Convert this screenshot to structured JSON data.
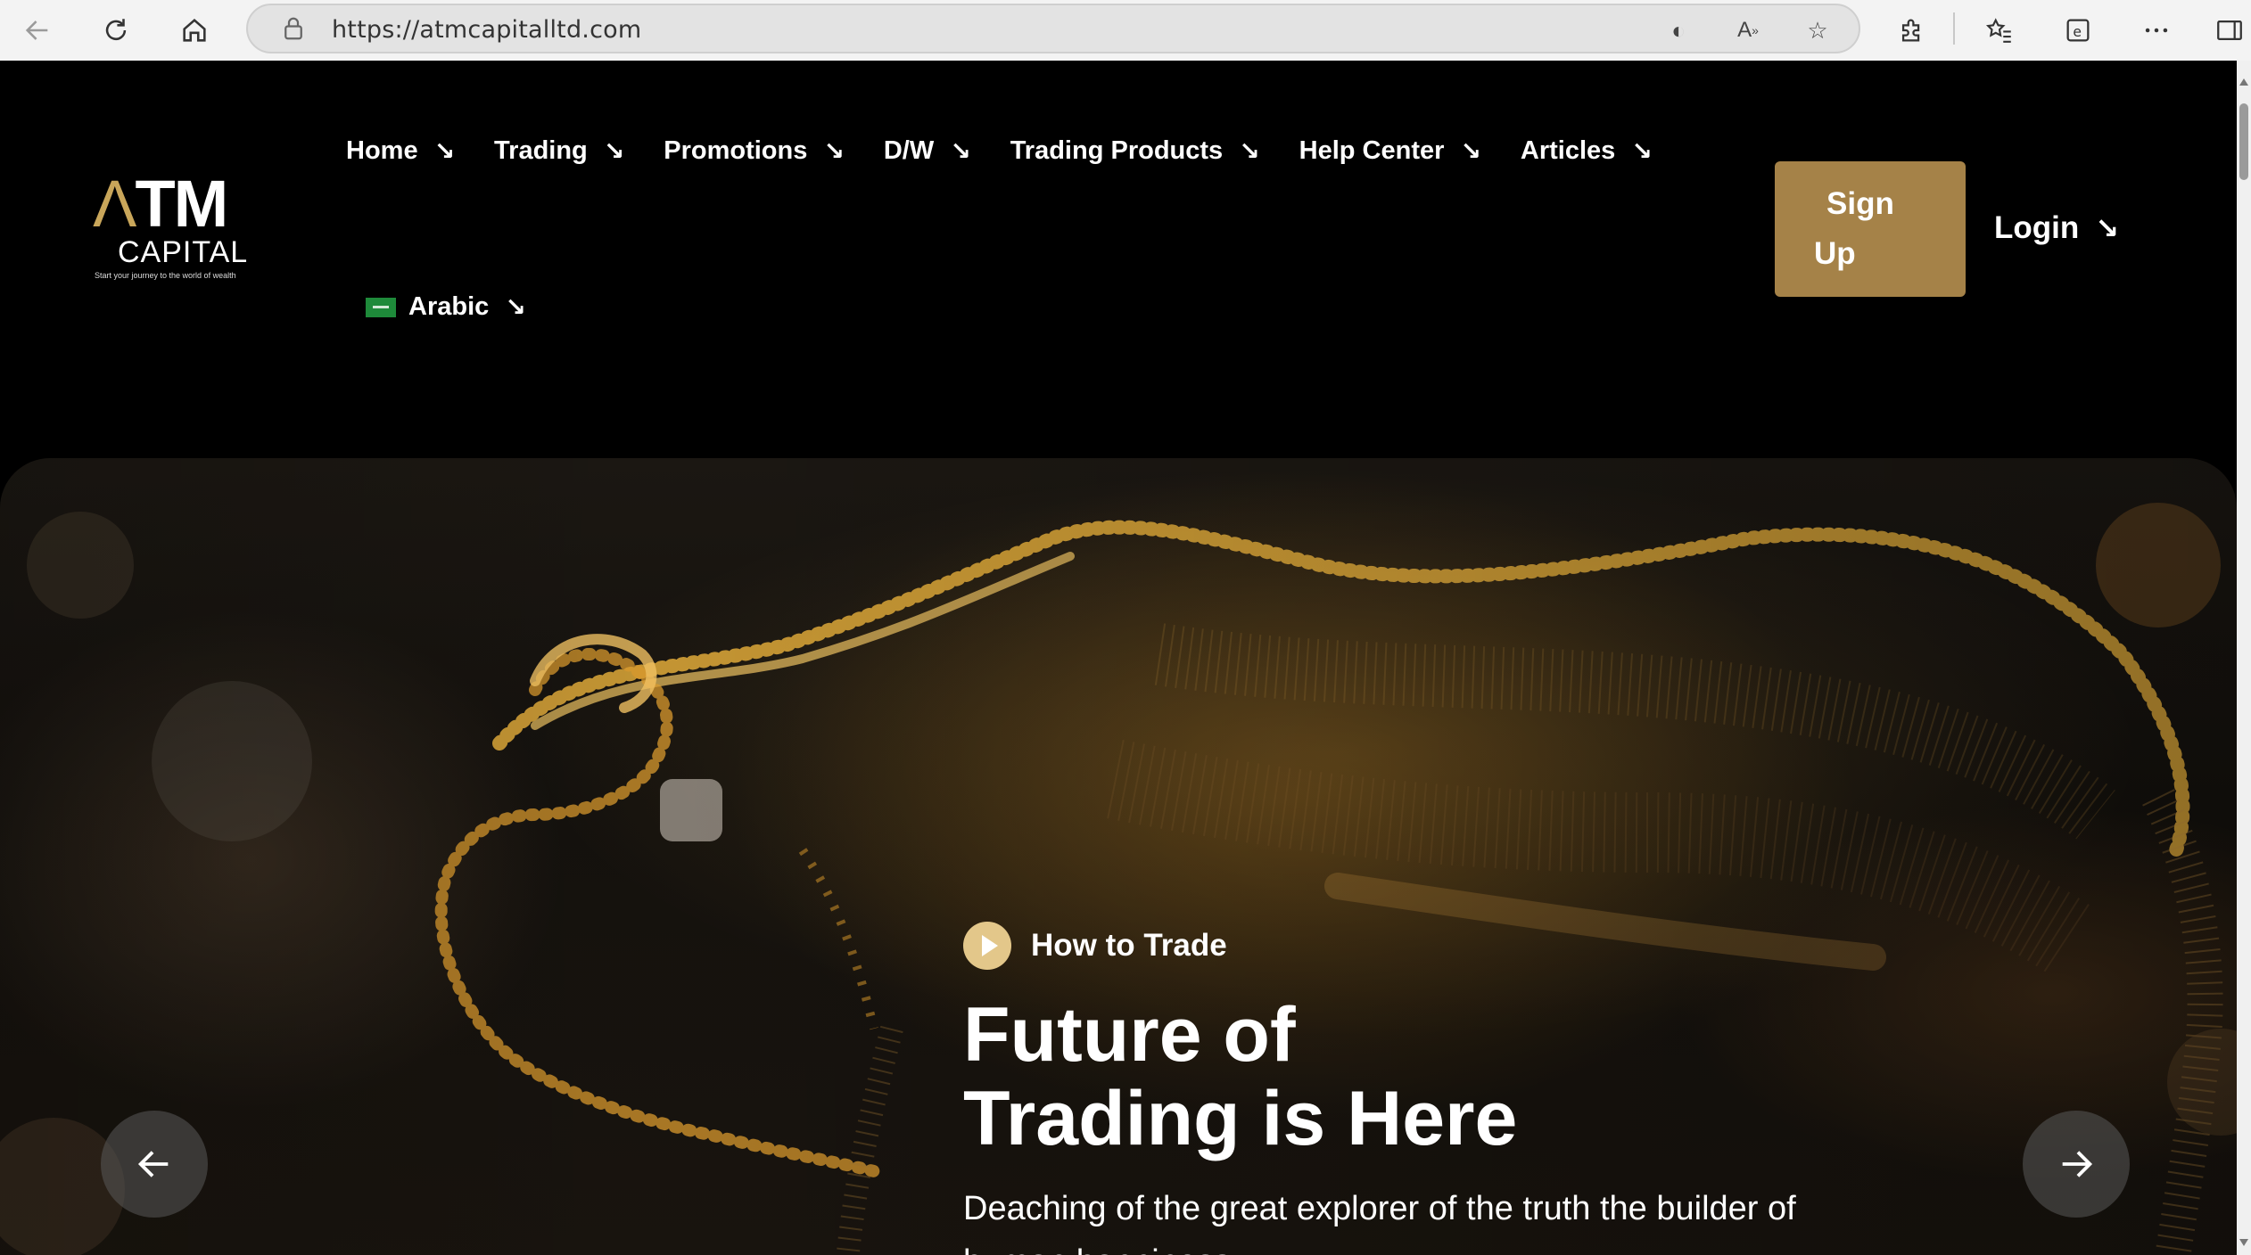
{
  "browser": {
    "url": "https://atmcapitalltd.com",
    "icons": {
      "back": "arrow-left-icon",
      "refresh": "refresh-icon",
      "home": "home-icon",
      "lock": "lock-icon",
      "tracking": "tracking-icon",
      "read_aloud": "read-aloud-icon",
      "favorite": "star-icon",
      "extensions": "puzzle-icon",
      "favorites": "favorites-list-icon",
      "collections": "collections-icon",
      "more": "more-dots-icon",
      "sidebar": "sidebar-icon"
    }
  },
  "logo": {
    "mark": "ATM",
    "subtitle": "CAPITAL",
    "tagline": "Start your journey to the world of wealth"
  },
  "nav": {
    "items": [
      {
        "label": "Home",
        "arrow": "↘"
      },
      {
        "label": "Trading",
        "arrow": "↘"
      },
      {
        "label": "Promotions",
        "arrow": "↘"
      },
      {
        "label": "D/W",
        "arrow": "↘"
      },
      {
        "label": "Trading Products",
        "arrow": "↘"
      },
      {
        "label": "Help Center",
        "arrow": "↘"
      },
      {
        "label": "Articles",
        "arrow": "↘"
      }
    ],
    "language": {
      "label": "Arabic",
      "arrow": "↘",
      "flag_color": "#1e8a3a"
    }
  },
  "auth": {
    "signup_line1": "Sign",
    "signup_line2": "Up",
    "login": "Login",
    "login_arrow": "↘",
    "signup_color": "#a58248"
  },
  "hero": {
    "eyebrow": "How to Trade",
    "headline_line1": "Future of",
    "headline_line2": "Trading is Here",
    "subtext": "Deaching of the great explorer of the truth the builder of human happiness.",
    "accent_color": "#e3c78a",
    "prev_icon": "arrow-left-icon",
    "next_icon": "arrow-right-icon"
  }
}
